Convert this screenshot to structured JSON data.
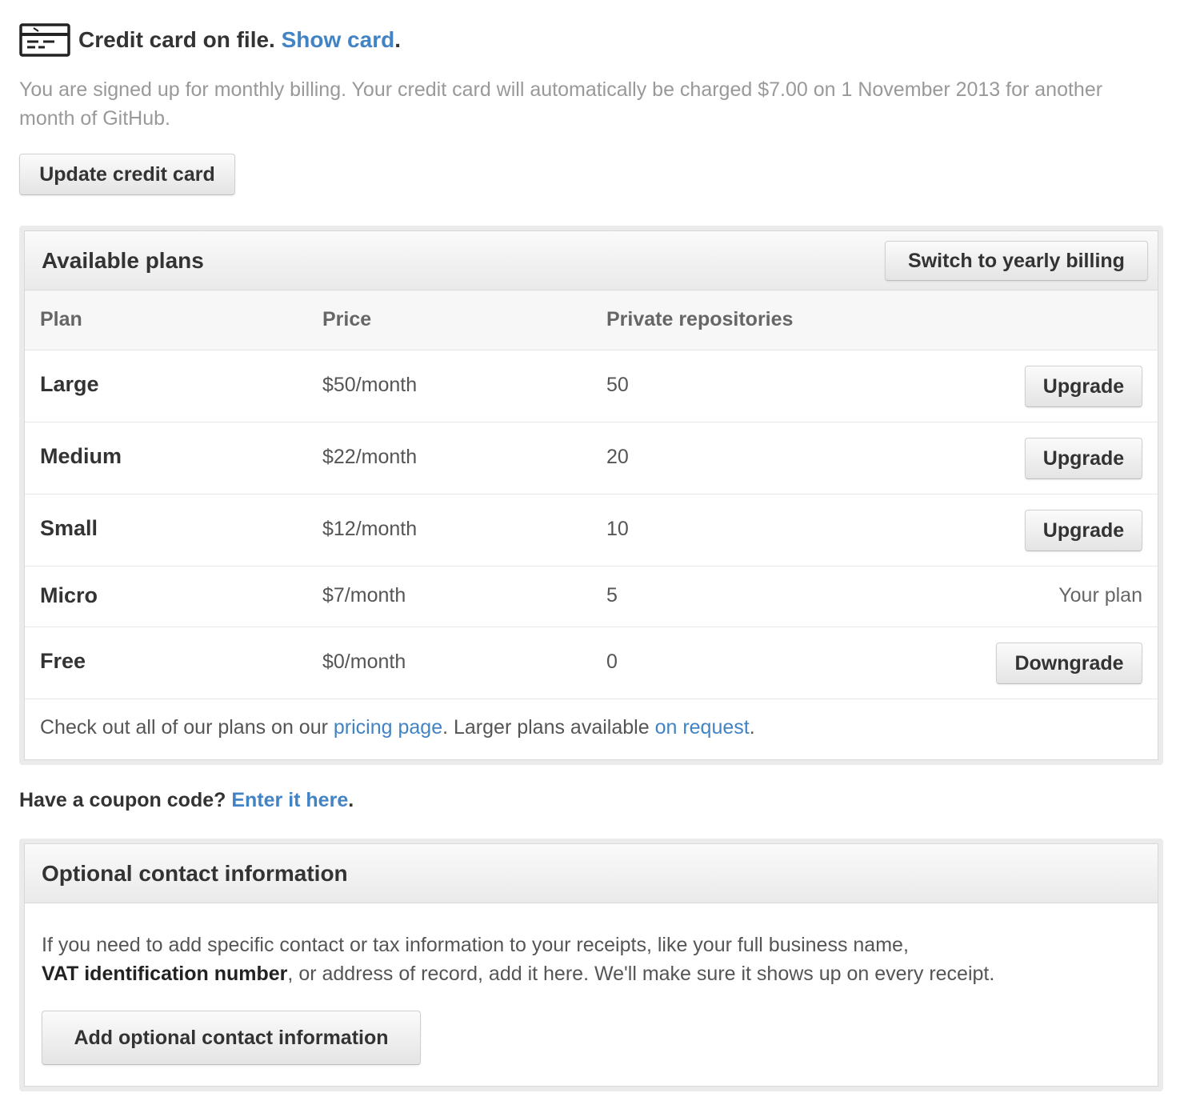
{
  "card": {
    "title": "Credit card on file.",
    "show_link": "Show card",
    "period": ".",
    "icon": "credit-card-icon"
  },
  "billing_note": "You are signed up for monthly billing. Your credit card will automatically be charged $7.00 on 1 November 2013 for another month of GitHub.",
  "update_button": "Update credit card",
  "plans": {
    "title": "Available plans",
    "switch_button": "Switch to yearly billing",
    "columns": {
      "plan": "Plan",
      "price": "Price",
      "repos": "Private repositories"
    },
    "rows": [
      {
        "name": "Large",
        "price": "$50/month",
        "repos": "50",
        "action": "Upgrade"
      },
      {
        "name": "Medium",
        "price": "$22/month",
        "repos": "20",
        "action": "Upgrade"
      },
      {
        "name": "Small",
        "price": "$12/month",
        "repos": "10",
        "action": "Upgrade"
      },
      {
        "name": "Micro",
        "price": "$7/month",
        "repos": "5",
        "status": "Your plan"
      },
      {
        "name": "Free",
        "price": "$0/month",
        "repos": "0",
        "action": "Downgrade"
      }
    ],
    "footer": {
      "prefix": "Check out all of our plans on our ",
      "pricing_link": "pricing page",
      "middle": ". Larger plans available ",
      "request_link": "on request",
      "suffix": "."
    }
  },
  "coupon": {
    "prefix": "Have a coupon code? ",
    "link": "Enter it here",
    "suffix": "."
  },
  "contact": {
    "title": "Optional contact information",
    "text_1": "If you need to add specific contact or tax information to your receipts, like your full business name,",
    "text_bold": "VAT identification number",
    "text_2": ", or address of record, add it here. We'll make sure it shows up on every receipt.",
    "button": "Add optional contact information"
  },
  "colors": {
    "link": "#4183c4",
    "muted_text": "#999999",
    "text": "#333333"
  }
}
